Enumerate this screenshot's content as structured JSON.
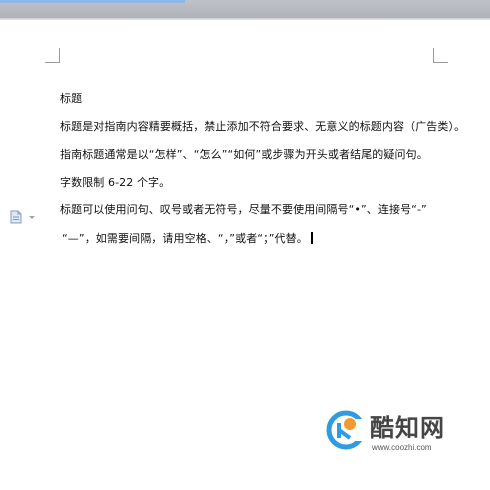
{
  "document": {
    "lines": [
      "标题",
      "标题是对指南内容精要概括，禁止添加不符合要求、无意义的标题内容（广告类）。",
      "指南标题通常是以“怎样”、“怎么”“如何”或步骤为开头或者结尾的疑问句。",
      "字数限制 6-22 个字。",
      "标题可以使用问句、叹号或者无符号，尽量不要使用间隔号“•”、连接号“-”",
      "“—”，如需要间隔，请用空格、“，”或者“；”代替。"
    ]
  },
  "watermark": {
    "name": "酷知网",
    "url": "www.coozhi.com"
  }
}
